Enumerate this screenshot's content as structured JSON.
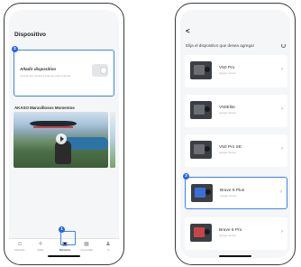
{
  "left_screen": {
    "title": "Dispositivo",
    "add_card": {
      "title": "Añadir dispositivo",
      "subtitle": "Vincula una cámara a esta app para empezar"
    },
    "section_title": "AKASO Maravillosos Momentos",
    "tabs": [
      {
        "label": "Descubrir",
        "icon": "compass-icon"
      },
      {
        "label": "Editar",
        "icon": "plus-icon"
      },
      {
        "label": "Dispositivo",
        "icon": "camera-icon"
      },
      {
        "label": "Comunidad",
        "icon": "grid-icon"
      },
      {
        "label": "Yo",
        "icon": "person-icon"
      }
    ],
    "badges": {
      "add_card": "2",
      "tab": "1"
    }
  },
  "right_screen": {
    "back_glyph": "<",
    "title": "Elija el dispositivo que desea agregar",
    "devices": [
      {
        "name": "V50 Pro",
        "subtitle": "Agregar cámara"
      },
      {
        "name": "V50Elite",
        "subtitle": "Agregar cámara"
      },
      {
        "name": "V50 Pro SE",
        "subtitle": "Agregar cámara"
      },
      {
        "name": "Brave 6 Plus",
        "subtitle": "Agregar cámara"
      },
      {
        "name": "Brave 6 Pro",
        "subtitle": "Agregar cámara"
      }
    ],
    "selected_badge": "3",
    "arrow_glyph": "›"
  },
  "colors": {
    "accent": "#3b82f6",
    "badge": "#2563eb"
  }
}
